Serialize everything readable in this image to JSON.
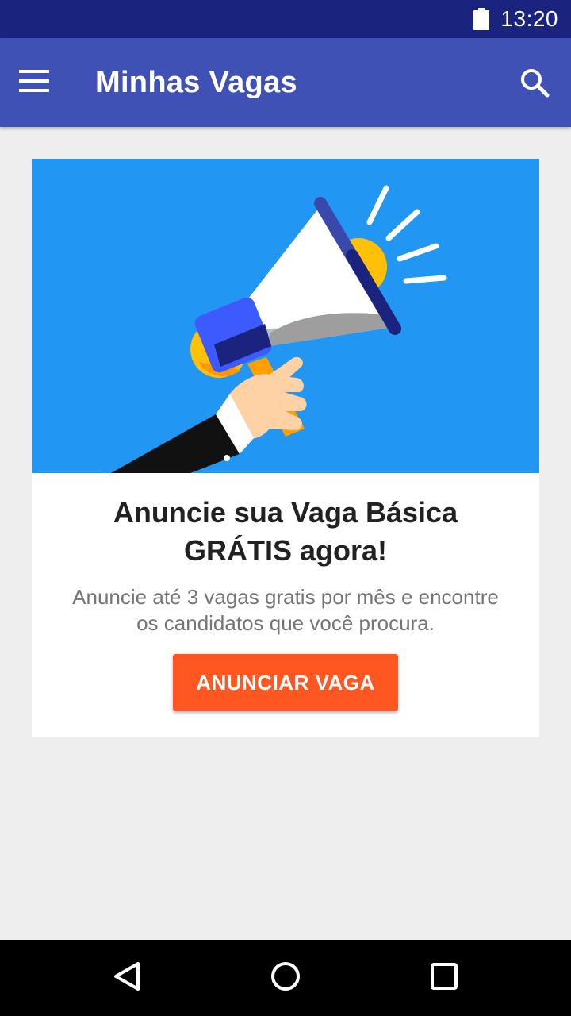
{
  "status_bar": {
    "time": "13:20",
    "battery_icon": "battery-full-icon"
  },
  "app_bar": {
    "title": "Minhas Vagas",
    "menu_icon": "menu-icon",
    "search_icon": "search-icon"
  },
  "promo_card": {
    "title_lines": [
      "Anuncie sua Vaga Básica",
      "GRÁTIS agora!"
    ],
    "description_lines": [
      "Anuncie até 3 vagas gratis por mês e encontre",
      "os candidatos que você procura."
    ],
    "button_label": "ANUNCIAR VAGA",
    "illustration": "megaphone-illustration"
  },
  "nav_bar": {
    "back_icon": "back-icon",
    "home_icon": "home-icon",
    "recents_icon": "recents-icon"
  },
  "colors": {
    "status_bar": "#1a237e",
    "app_bar": "#3f51b5",
    "background": "#eeeeee",
    "hero": "#2196f3",
    "cta": "#ff5722"
  }
}
